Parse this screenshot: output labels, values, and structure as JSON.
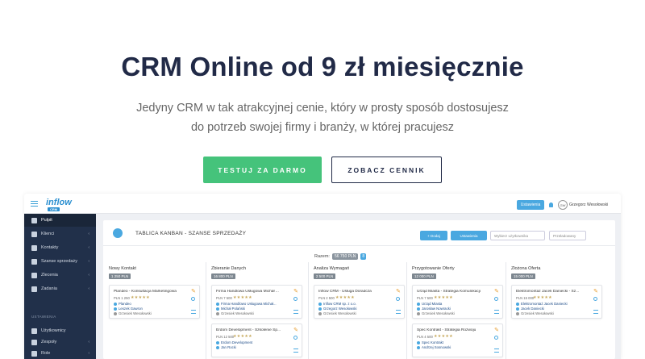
{
  "hero": {
    "title": "CRM Online od 9 zł miesięcznie",
    "subtitle_line1": "Jedyny CRM w tak atrakcyjnej cenie, który w prosty sposób dostosujesz",
    "subtitle_line2": "do potrzeb swojej firmy i branży, w której pracujesz",
    "cta_primary": "TESTUJ ZA DARMO",
    "cta_secondary": "ZOBACZ CENNIK"
  },
  "app": {
    "logo": "inflow",
    "logo_badge": "CRM",
    "topbar_button": "Ustawienia",
    "avatar_initials": "GW",
    "user_name": "Grzegorz Wesołowski",
    "sidebar": {
      "items": [
        {
          "label": "Pulpit",
          "icon": "home-icon",
          "active": true
        },
        {
          "label": "Klienci",
          "icon": "building-icon"
        },
        {
          "label": "Kontakty",
          "icon": "people-icon"
        },
        {
          "label": "Szanse sprzedaży",
          "icon": "chart-icon"
        },
        {
          "label": "Zlecenia",
          "icon": "document-icon"
        },
        {
          "label": "Zadania",
          "icon": "tasks-icon"
        }
      ],
      "section_label": "USTAWIENIA",
      "settings_items": [
        {
          "label": "Użytkownicy",
          "icon": "gear-icon"
        },
        {
          "label": "Zespoły",
          "icon": "team-icon"
        },
        {
          "label": "Role",
          "icon": "role-icon"
        }
      ]
    },
    "panel": {
      "title": "TABLICA KANBAN - SZANSE SPRZEDAŻY",
      "btn_add": "+ Dodaj",
      "btn_settings": "Ustawienia",
      "filter_user": "Wybierz użytkownika",
      "filter_sort": "Przeładowany",
      "total_label": "Razem:",
      "total_value": "56 750 PLN",
      "total_count": "8"
    },
    "columns": [
      {
        "title": "Nowy Kontakt",
        "amount": "1 250 PLN",
        "cards": [
          {
            "title": "Plandeo - Konsultacja Marketingowa",
            "price": "PLN 1 250",
            "company": "Plandeo",
            "contact": "Leszek Gawron",
            "owner": "Grzesiek Wesołowski"
          }
        ]
      },
      {
        "title": "Zbieranie Danych",
        "amount": "16 800 PLN",
        "cards": [
          {
            "title": "Firma Handlowa Usługowa Michał ...",
            "price": "PLN 7 500",
            "company": "Firma Handlowo Usługowa Michał...",
            "contact": "Michał Polański",
            "owner": "Grzesiek Wesołowski"
          },
          {
            "title": "Erdom Development - Szkolenie Sp...",
            "price": "PLN 12 500",
            "company": "Erdom Development",
            "contact": "Jan Rocki",
            "owner": ""
          }
        ]
      },
      {
        "title": "Analiza Wymagań",
        "amount": "2 500 PLN",
        "cards": [
          {
            "title": "Inflow CRM - Usługa Doradcza",
            "price": "PLN 2 500",
            "company": "Inflow CRM sp. z o.o.",
            "contact": "Grzegorz Wesołowski",
            "owner": "Grzesiek Wesołowski"
          }
        ]
      },
      {
        "title": "Przygotowanie Oferty",
        "amount": "12 000 PLN",
        "cards": [
          {
            "title": "Urząd Miasta - Strategia Komunikacji",
            "price": "PLN 7 500",
            "company": "Urząd Miasta",
            "contact": "Jarosław Nowracki",
            "owner": "Grzesiek Wesołowski"
          },
          {
            "title": "Spec Kontrakt - Strategia Rozwoju",
            "price": "PLN 4 500",
            "company": "Spec Kontrakt",
            "contact": "Andrzej Sosnowski",
            "owner": ""
          }
        ]
      },
      {
        "title": "Złożona Oferta",
        "amount": "15 000 PLN",
        "cards": [
          {
            "title": "Elektromontaż Jacek Daniecki - Sz...",
            "price": "PLN 15 000",
            "company": "Elektromontaż Jacek Daniecki",
            "contact": "Jacek Daniecki",
            "owner": "Grzesiek Wesołowski"
          }
        ]
      }
    ],
    "stars": "★★★★★"
  },
  "colors": {
    "accent": "#45c37b",
    "navy": "#212a47",
    "sidebar": "#21304a",
    "blue": "#4aa8e0"
  }
}
